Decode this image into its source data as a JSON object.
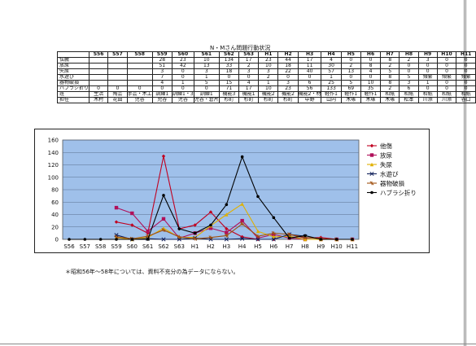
{
  "header": {
    "title": "N・Mさん問題行動状況"
  },
  "table": {
    "years": [
      "S56",
      "S57",
      "S58",
      "S59",
      "S60",
      "S61",
      "S62",
      "S63",
      "H1",
      "H2",
      "H3",
      "H4",
      "H5",
      "H6",
      "H7",
      "H8",
      "H9",
      "H10",
      "H11"
    ],
    "rows": [
      {
        "label": "怯騰",
        "cells": [
          "",
          "",
          "",
          "28",
          "23",
          "10",
          "134",
          "17",
          "23",
          "44",
          "17",
          "4",
          "0",
          "0",
          "8",
          "2",
          "3",
          "0",
          "0"
        ]
      },
      {
        "label": "放尿",
        "cells": [
          "",
          "",
          "",
          "51",
          "42",
          "13",
          "33",
          "2",
          "10",
          "18",
          "11",
          "30",
          "2",
          "8",
          "2",
          "0",
          "0",
          "0",
          "0"
        ]
      },
      {
        "label": "失尿",
        "cells": [
          "",
          "",
          "",
          "3",
          "0",
          "3",
          "18",
          "3",
          "3",
          "22",
          "40",
          "57",
          "13",
          "4",
          "5",
          "0",
          "0",
          "0",
          "0"
        ]
      },
      {
        "label": "水遊び",
        "cells": [
          "",
          "",
          "",
          "7",
          "0",
          "1",
          "0",
          "0",
          "2",
          "0",
          "0",
          "1",
          "0",
          "0",
          "8",
          "5",
          "頻繁",
          "頻繁",
          "頻繁"
        ]
      },
      {
        "label": "器物破損",
        "cells": [
          "",
          "",
          "",
          "4",
          "1",
          "5",
          "15",
          "4",
          "1",
          "3",
          "6",
          "25",
          "5",
          "10",
          "8",
          "3",
          "1",
          "0",
          "0"
        ]
      },
      {
        "label": "ハブラシ折り",
        "cells": [
          "0",
          "0",
          "0",
          "0",
          "0",
          "0",
          "71",
          "17",
          "10",
          "23",
          "56",
          "133",
          "69",
          "35",
          "2",
          "6",
          "0",
          "0",
          "0"
        ]
      },
      {
        "label": "班",
        "cells": [
          "生活",
          "陶芸",
          "手芸・木工",
          "訓練1",
          "訓練1・3",
          "訓練1",
          "機能3",
          "機能1",
          "機能2",
          "機能2",
          "機能2・材",
          "軽作1",
          "軽作1",
          "軽作1",
          "和紙",
          "和紙",
          "和紙",
          "和紙",
          "和紙"
        ]
      },
      {
        "label": "担任",
        "cells": [
          "木村",
          "花田",
          "児谷",
          "児谷",
          "児谷",
          "児谷・倉片",
          "杉町",
          "杉町",
          "杉町",
          "杉町",
          "中野",
          "山内",
          "木塚",
          "木塚",
          "木塚",
          "松本",
          "川添",
          "川添",
          "谷口"
        ]
      }
    ]
  },
  "chart_data": {
    "type": "line",
    "categories": [
      "S56",
      "S57",
      "S58",
      "S59",
      "S60",
      "S61",
      "S62",
      "S63",
      "H1",
      "H2",
      "H3",
      "H4",
      "H5",
      "H6",
      "H7",
      "H8",
      "H9",
      "H10",
      "H11"
    ],
    "ylim": [
      0,
      160
    ],
    "yticks": [
      "0",
      "20",
      "40",
      "60",
      "80",
      "100",
      "120",
      "140",
      "160"
    ],
    "grid": true,
    "legend_position": "right",
    "series": [
      {
        "name": "他傷",
        "color": "#c00020",
        "marker": "diamond",
        "values": [
          null,
          null,
          null,
          28,
          23,
          10,
          134,
          17,
          23,
          44,
          17,
          4,
          0,
          0,
          8,
          2,
          3,
          0,
          0
        ]
      },
      {
        "name": "放尿",
        "color": "#b0105a",
        "marker": "square",
        "values": [
          null,
          null,
          null,
          51,
          42,
          13,
          33,
          2,
          10,
          18,
          11,
          30,
          2,
          8,
          2,
          0,
          0,
          0,
          0
        ]
      },
      {
        "name": "失尿",
        "color": "#e0b000",
        "marker": "triangle",
        "values": [
          null,
          null,
          null,
          3,
          0,
          3,
          18,
          3,
          3,
          22,
          40,
          57,
          13,
          4,
          5,
          0,
          0,
          0,
          0
        ]
      },
      {
        "name": "水遊び",
        "color": "#10205a",
        "marker": "x",
        "values": [
          null,
          null,
          null,
          7,
          0,
          1,
          0,
          0,
          2,
          0,
          0,
          1,
          0,
          0,
          8,
          5,
          null,
          null,
          null
        ]
      },
      {
        "name": "器物破損",
        "color": "#a05010",
        "marker": "star",
        "values": [
          null,
          null,
          null,
          4,
          1,
          5,
          15,
          4,
          1,
          3,
          6,
          25,
          5,
          10,
          8,
          3,
          1,
          0,
          0
        ]
      },
      {
        "name": "ハブラシ折り",
        "color": "#000000",
        "marker": "circle",
        "values": [
          0,
          0,
          0,
          0,
          0,
          0,
          71,
          17,
          10,
          23,
          56,
          133,
          69,
          35,
          2,
          6,
          0,
          0,
          0
        ]
      }
    ]
  },
  "footnote": "＊昭和56年～58年については、資料不充分の為データにならない。"
}
